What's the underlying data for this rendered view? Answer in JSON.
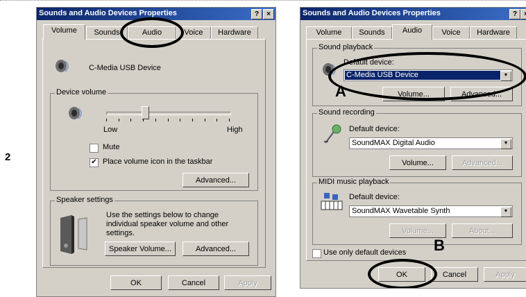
{
  "step_number": "2",
  "left_window": {
    "title": "Sounds and Audio Devices Properties",
    "title_buttons": [
      "?",
      "×"
    ],
    "tabs": [
      "Volume",
      "Sounds",
      "Audio",
      "Voice",
      "Hardware"
    ],
    "active_tab": "Volume",
    "device_name": "C-Media USB Device",
    "device_volume_group": "Device volume",
    "slider_low": "Low",
    "slider_high": "High",
    "slider_level": 0.3,
    "mute_label": "Mute",
    "mute_checked": false,
    "place_icon_label": "Place volume icon in the taskbar",
    "place_icon_checked": true,
    "advanced_button": "Advanced...",
    "speaker_group": "Speaker settings",
    "speaker_text": "Use the settings below to change individual speaker volume and other settings.",
    "speaker_volume_button": "Speaker Volume...",
    "speaker_advanced_button": "Advanced...",
    "ok_button": "OK",
    "cancel_button": "Cancel",
    "apply_button": "Apply"
  },
  "right_window": {
    "title": "Sounds and Audio Devices Properties",
    "title_buttons": [
      "?",
      "×"
    ],
    "tabs": [
      "Volume",
      "Sounds",
      "Audio",
      "Voice",
      "Hardware"
    ],
    "active_tab": "Audio",
    "playback_group": "Sound playback",
    "playback_default_label": "Default device:",
    "playback_device": "C-Media USB Device",
    "playback_volume_button": "Volume...",
    "playback_advanced_button": "Advanced...",
    "recording_group": "Sound recording",
    "recording_default_label": "Default device:",
    "recording_device": "SoundMAX Digital Audio",
    "recording_volume_button": "Volume...",
    "recording_advanced_button": "Advanced...",
    "midi_group": "MIDI music playback",
    "midi_default_label": "Default device:",
    "midi_device": "SoundMAX Wavetable Synth",
    "midi_volume_button": "Volume...",
    "midi_about_button": "About...",
    "use_default_label": "Use only default devices",
    "use_default_checked": false,
    "ok_button": "OK",
    "cancel_button": "Cancel",
    "apply_button": "Apply"
  },
  "annotations": {
    "a": "A",
    "b": "B"
  }
}
